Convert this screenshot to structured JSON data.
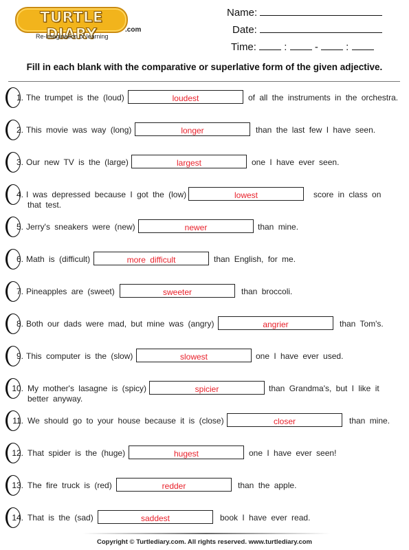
{
  "header": {
    "logo_text": "TURTLE DIARY",
    "logo_domain": ".com",
    "tagline": "Re-Imagination of learning",
    "name_label": "Name:",
    "date_label": "Date:",
    "time_label": "Time:",
    "time_separator_colon": ":",
    "time_separator_dash": "-"
  },
  "instructions": "Fill in each blank with the comparative or superlative form of the given adjective.",
  "answer_color": "#e8202a",
  "questions": [
    {
      "number": "1.",
      "before": "The trumpet is the (loud)",
      "answer": "loudest",
      "after": "of all the instruments in the orchestra.",
      "after2": ""
    },
    {
      "number": "2.",
      "before": "This movie was way (long)",
      "answer": "longer",
      "after": "than the last few I have seen.",
      "after2": ""
    },
    {
      "number": "3.",
      "before": "Our new TV is the (large)",
      "answer": "largest",
      "after": "one I have ever seen.",
      "after2": ""
    },
    {
      "number": "4.",
      "before": "I was depressed because I got the (low)",
      "answer": "lowest",
      "after": "score in class on",
      "after2": "that test."
    },
    {
      "number": "5.",
      "before": "Jerry's sneakers were (new)",
      "answer": "newer",
      "after": "than mine.",
      "after2": ""
    },
    {
      "number": "6.",
      "before": "Math is (difficult)",
      "answer": "more difficult",
      "after": "than English, for me.",
      "after2": ""
    },
    {
      "number": "7.",
      "before": "Pineapples are (sweet)",
      "answer": "sweeter",
      "after": "than broccoli.",
      "after2": ""
    },
    {
      "number": "8.",
      "before": "Both our dads were mad, but mine was (angry)",
      "answer": "angrier",
      "after": "than Tom's.",
      "after2": ""
    },
    {
      "number": "9.",
      "before": "This computer is the (slow)",
      "answer": "slowest",
      "after": "one I have ever used.",
      "after2": ""
    },
    {
      "number": "10.",
      "before": "My mother's lasagne is (spicy)",
      "answer": "spicier",
      "after": "than Grandma's, but I like it",
      "after2": "better anyway."
    },
    {
      "number": "11.",
      "before": "We should go to your house because it is (close)",
      "answer": "closer",
      "after": "than mine.",
      "after2": ""
    },
    {
      "number": "12.",
      "before": "That spider is the (huge)",
      "answer": "hugest",
      "after": "one I have ever seen!",
      "after2": ""
    },
    {
      "number": "13.",
      "before": "The fire truck is (red)",
      "answer": "redder",
      "after": "than the apple.",
      "after2": ""
    },
    {
      "number": "14.",
      "before": "That is the (sad)",
      "answer": "saddest",
      "after": "book I have ever read.",
      "after2": ""
    }
  ],
  "footer": "Copyright © Turtlediary.com. All rights reserved. www.turtlediary.com"
}
